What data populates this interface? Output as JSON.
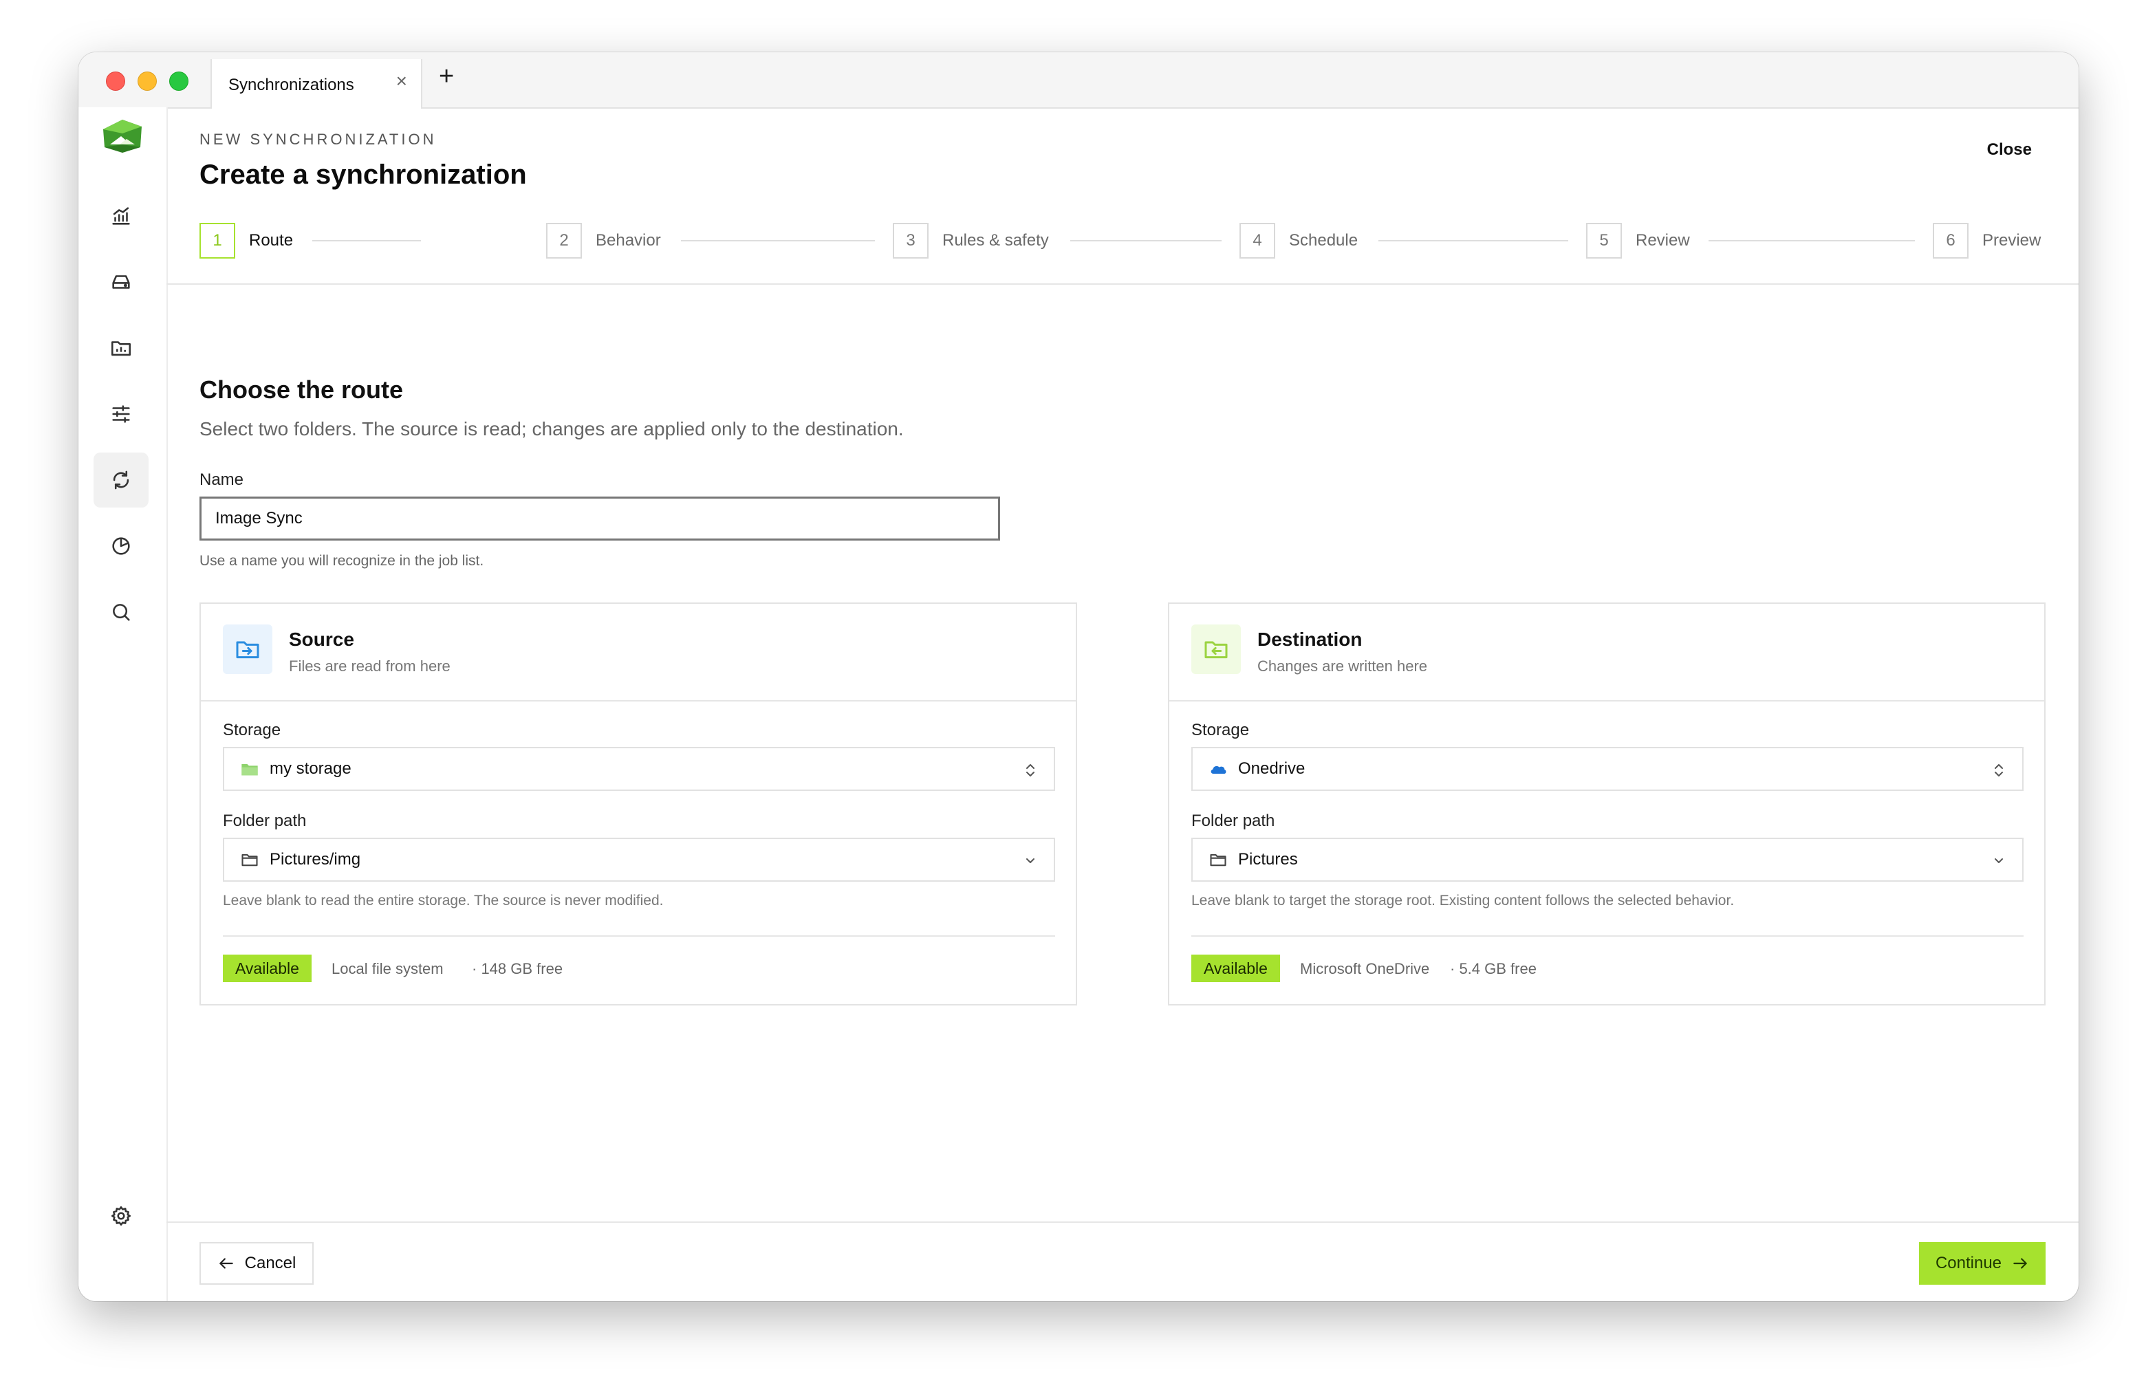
{
  "tabs": [
    {
      "label": "Synchronizations",
      "close": "×"
    }
  ],
  "new_tab": "+",
  "header": {
    "eyebrow": "NEW SYNCHRONIZATION",
    "title": "Create a synchronization",
    "close": "Close"
  },
  "steps": [
    {
      "num": "1",
      "label": "Route",
      "active": true
    },
    {
      "num": "2",
      "label": "Behavior"
    },
    {
      "num": "3",
      "label": "Rules & safety"
    },
    {
      "num": "4",
      "label": "Schedule"
    },
    {
      "num": "5",
      "label": "Review"
    },
    {
      "num": "6",
      "label": "Preview"
    }
  ],
  "section": {
    "title": "Choose the route",
    "subtitle": "Select two folders. The source is read; changes are applied only to the destination."
  },
  "name_field": {
    "label": "Name",
    "value": "Image Sync",
    "hint": "Use a name you will recognize in the job list."
  },
  "source": {
    "title": "Source",
    "subtitle": "Files are read from here",
    "storage_label": "Storage",
    "storage_value": "my storage",
    "folder_label": "Folder path",
    "folder_value": "Pictures/img",
    "hint": "Leave blank to read the entire storage. The source is never modified.",
    "badge": "Available",
    "provider": "Local file system",
    "free": "· 148 GB free"
  },
  "destination": {
    "title": "Destination",
    "subtitle": "Changes are written here",
    "storage_label": "Storage",
    "storage_value": "Onedrive",
    "folder_label": "Folder path",
    "folder_value": "Pictures",
    "hint": "Leave blank to target the storage root. Existing content follows the selected behavior.",
    "badge": "Available",
    "provider": "Microsoft OneDrive",
    "free": "· 5.4 GB free"
  },
  "footer": {
    "cancel": "Cancel",
    "continue": "Continue"
  },
  "colors": {
    "accent": "#a6e22e",
    "source_icon": "#2b8de0",
    "destination_icon": "#9bd341"
  },
  "sidebar_icons": [
    "analytics-icon",
    "drive-icon",
    "folder-chart-icon",
    "sliders-icon",
    "sync-icon",
    "pie-chart-icon",
    "search-icon",
    "settings-icon"
  ]
}
